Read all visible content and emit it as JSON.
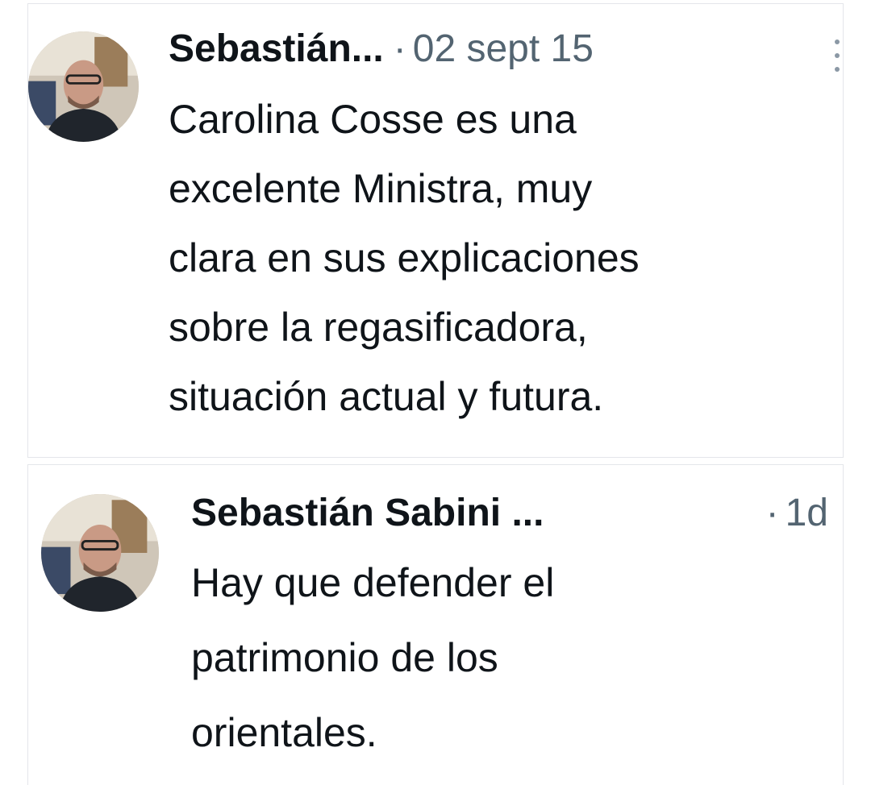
{
  "tweets": [
    {
      "author": "Sebastián...",
      "separator": "·",
      "date": "02 sept 15",
      "more_icon": "more-vertical-icon",
      "text": "Carolina Cosse es una\nexcelente Ministra, muy\nclara en sus explicaciones\nsobre la regasificadora,\nsituación actual y futura."
    },
    {
      "author": "Sebastián Sabini ...",
      "separator": "·",
      "date": "1d",
      "text": "Hay que defender el\npatrimonio de los\norientales."
    }
  ],
  "colors": {
    "text": "#0f1419",
    "muted": "#536471",
    "border": "#e4e6ea",
    "background": "#ffffff"
  }
}
